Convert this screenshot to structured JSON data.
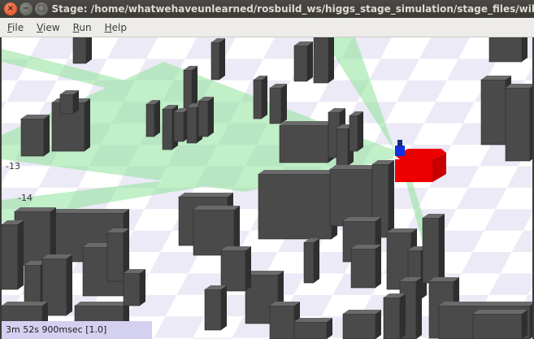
{
  "window": {
    "title": "Stage: /home/whatwehaveunlearned/rosbuild_ws/higgs_stage_simulation/stage_files/will",
    "buttons": {
      "close": "×",
      "minimize": "−",
      "maximize": "□"
    }
  },
  "menu": [
    {
      "mnemonic": "F",
      "rest": "ile"
    },
    {
      "mnemonic": "V",
      "rest": "iew"
    },
    {
      "mnemonic": "R",
      "rest": "un"
    },
    {
      "mnemonic": "H",
      "rest": "elp"
    }
  ],
  "world": {
    "grid_labels": [
      "-13",
      "-14"
    ],
    "colors": {
      "floor_light": "#eceaf6",
      "floor_dark": "#ffffff",
      "building": "#4a4a4a",
      "laser": "#8fe39a",
      "robot_body": "#ee0000",
      "robot_sensor": "#1030e0"
    }
  },
  "status": {
    "clock": "3m 52s 900msec [1.0]"
  }
}
